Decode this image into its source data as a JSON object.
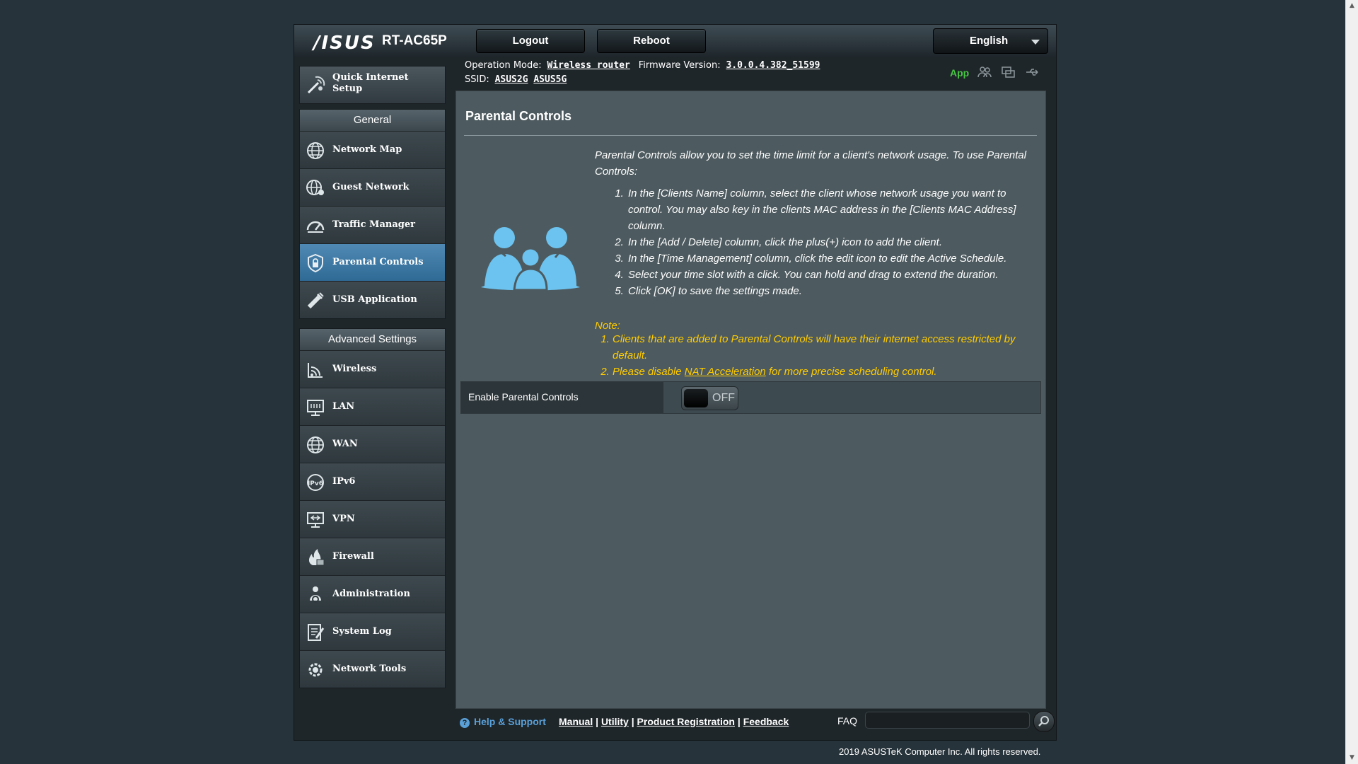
{
  "header": {
    "brand": "/ISUS",
    "model": "RT-AC65P",
    "logout_label": "Logout",
    "reboot_label": "Reboot",
    "language": "English"
  },
  "menu": {
    "quick_setup": "Quick Internet Setup",
    "general_title": "General",
    "general_items": [
      {
        "label": "Network Map",
        "icon": "globe-icon"
      },
      {
        "label": "Guest Network",
        "icon": "guest-globe-icon"
      },
      {
        "label": "Traffic Manager",
        "icon": "gauge-icon"
      },
      {
        "label": "Parental Controls",
        "icon": "shield-lock-icon",
        "active": true
      },
      {
        "label": "USB Application",
        "icon": "usb-icon"
      }
    ],
    "advanced_title": "Advanced Settings",
    "advanced_items": [
      {
        "label": "Wireless",
        "icon": "wireless-icon"
      },
      {
        "label": "LAN",
        "icon": "lan-icon"
      },
      {
        "label": "WAN",
        "icon": "wan-globe-icon"
      },
      {
        "label": "IPv6",
        "icon": "ipv6-icon"
      },
      {
        "label": "VPN",
        "icon": "vpn-icon"
      },
      {
        "label": "Firewall",
        "icon": "firewall-icon"
      },
      {
        "label": "Administration",
        "icon": "admin-gear-icon"
      },
      {
        "label": "System Log",
        "icon": "system-log-icon"
      },
      {
        "label": "Network Tools",
        "icon": "network-tools-icon"
      }
    ]
  },
  "status": {
    "op_mode_label": "Operation Mode:",
    "op_mode_value": "Wireless router",
    "fw_label": "Firmware Version:",
    "fw_value": "3.0.0.4.382_51599",
    "ssid_label": "SSID:",
    "ssid_1": "ASUS2G",
    "ssid_2": "ASUS5G",
    "app_label": "App"
  },
  "content": {
    "title": "Parental Controls",
    "intro": "Parental Controls allow you to set the time limit for a client's network usage. To use Parental Controls:",
    "steps": [
      "In the [Clients Name] column, select the client whose network usage you want to control. You may also key in the clients MAC address in the [Clients MAC Address] column.",
      "In the [Add / Delete] column, click the plus(+) icon to add the client.",
      "In the [Time Management] column, click the edit icon to edit the Active Schedule.",
      "Select your time slot with a click. You can hold and drag to extend the duration.",
      "Click [OK] to save the settings made."
    ],
    "note_label": "Note:",
    "note_1": "Clients that are added to Parental Controls will have their internet access restricted by default.",
    "note_2_pre": "Please disable ",
    "note_2_link": "NAT Acceleration",
    "note_2_post": " for more precise scheduling control.",
    "enable_label": "Enable Parental Controls",
    "toggle_state": "OFF"
  },
  "footer": {
    "help_label": "Help & Support",
    "manual": "Manual",
    "utility": "Utility",
    "registration": "Product Registration",
    "feedback": "Feedback",
    "faq_label": "FAQ",
    "faq_value": "",
    "copyright": "2019 ASUSTeK Computer Inc. All rights reserved."
  },
  "colors": {
    "active_menu": "#3d79a5",
    "note_text": "#ffcc00",
    "app_green": "#47c444",
    "help_blue": "#59a0d8"
  }
}
